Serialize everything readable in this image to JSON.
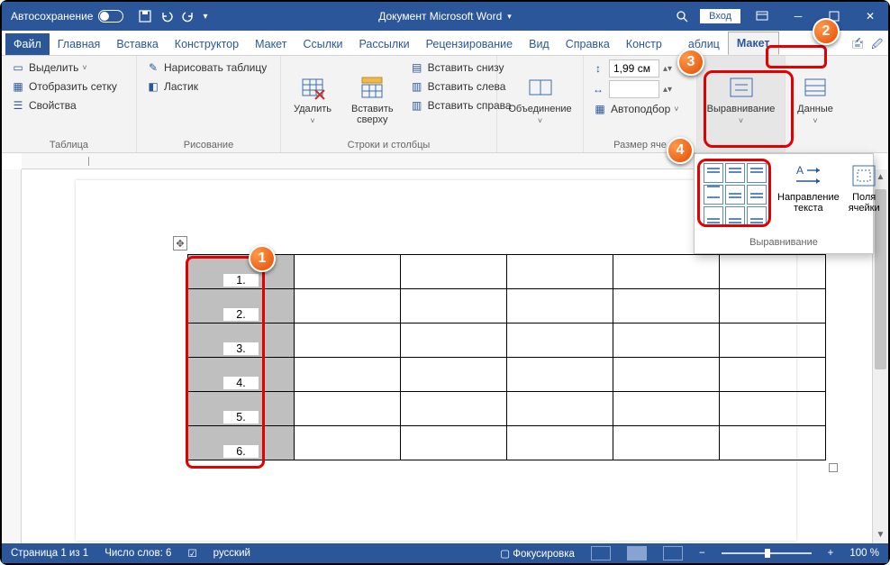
{
  "titlebar": {
    "autosave": "Автосохранение",
    "title": "Документ Microsoft Word",
    "login": "Вход"
  },
  "tabs": {
    "file": "Файл",
    "home": "Главная",
    "insert": "Вставка",
    "design": "Конструктор",
    "layout": "Макет",
    "references": "Ссылки",
    "mailings": "Рассылки",
    "review": "Рецензирование",
    "view": "Вид",
    "help": "Справка",
    "table_design": "Констр",
    "table_design_suffix": "аблиц",
    "table_layout": "Макет"
  },
  "ribbon": {
    "table_group": {
      "label": "Таблица",
      "select": "Выделить",
      "gridlines": "Отобразить сетку",
      "properties": "Свойства"
    },
    "draw_group": {
      "label": "Рисование",
      "draw_table": "Нарисовать таблицу",
      "eraser": "Ластик"
    },
    "rowscols_group": {
      "label": "Строки и столбцы",
      "delete": "Удалить",
      "insert_above": "Вставить сверху",
      "insert_below": "Вставить снизу",
      "insert_left": "Вставить слева",
      "insert_right": "Вставить справа"
    },
    "merge_group": {
      "merge": "Объединение"
    },
    "cellsize_group": {
      "label": "Размер яче",
      "height": "1,99 см",
      "autofit": "Автоподбор"
    },
    "alignment_group": {
      "label": "Выравнивание"
    },
    "data_group": {
      "label": "Данные"
    }
  },
  "popup": {
    "text_direction": "Направление текста",
    "cell_margins": "Поля ячейки",
    "label": "Выравнивание"
  },
  "table_rows": [
    "1.",
    "2.",
    "3.",
    "4.",
    "5.",
    "6."
  ],
  "status": {
    "page": "Страница 1 из 1",
    "words": "Число слов: 6",
    "language": "русский",
    "focus": "Фокусировка",
    "zoom": "100 %"
  },
  "callouts": {
    "c1": "1",
    "c2": "2",
    "c3": "3",
    "c4": "4"
  }
}
